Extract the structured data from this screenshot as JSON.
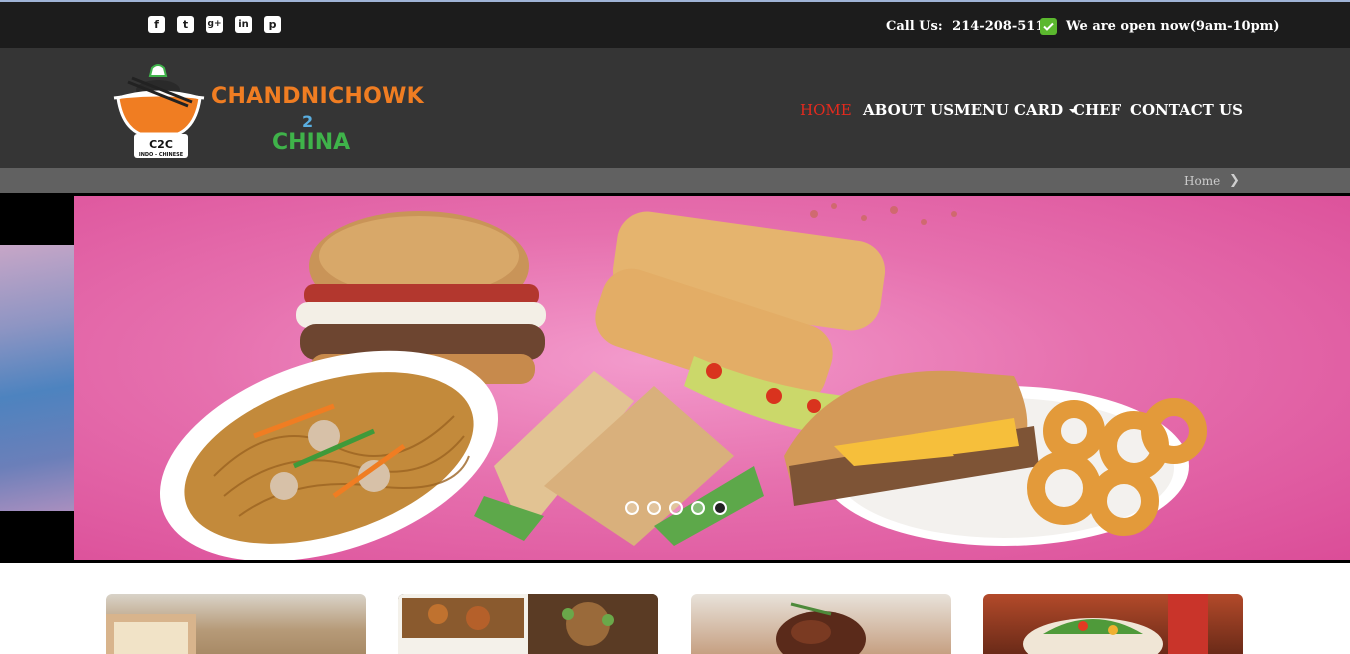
{
  "topbar": {
    "social_icons": [
      "facebook-icon",
      "twitter-icon",
      "google-plus-icon",
      "linkedin-icon",
      "pinterest-icon"
    ],
    "social_glyphs": [
      "f",
      "t",
      "g+",
      "in",
      "p"
    ],
    "call_label": "Call Us:",
    "phone": "214-208-5114",
    "open_status": "We are open now(9am-10pm)"
  },
  "brand": {
    "line1": "CHANDNICHOWK",
    "line2": "2",
    "line3": "CHINA",
    "badge_text": "INDO - CHINESE",
    "colors": {
      "orange": "#f07d22",
      "blue": "#5aaee0",
      "green": "#3fb34a"
    }
  },
  "nav": {
    "items": [
      {
        "label": "HOME",
        "active": true
      },
      {
        "label": "ABOUT US",
        "active": false
      },
      {
        "label": "MENU CARD",
        "active": false,
        "dropdown": true
      },
      {
        "label": "CHEF",
        "active": false
      },
      {
        "label": "CONTACT US",
        "active": false
      }
    ],
    "active_color": "#e52a1e"
  },
  "breadcrumb": {
    "label": "Home"
  },
  "slider": {
    "dot_count": 5,
    "active_dot": 5
  },
  "colors": {
    "topbar_bg": "#1c1c1c",
    "header_bg": "#353535",
    "breadcrumb_bg": "#616161",
    "slide_pink": "#e670ae",
    "check_green": "#5bb82e"
  }
}
